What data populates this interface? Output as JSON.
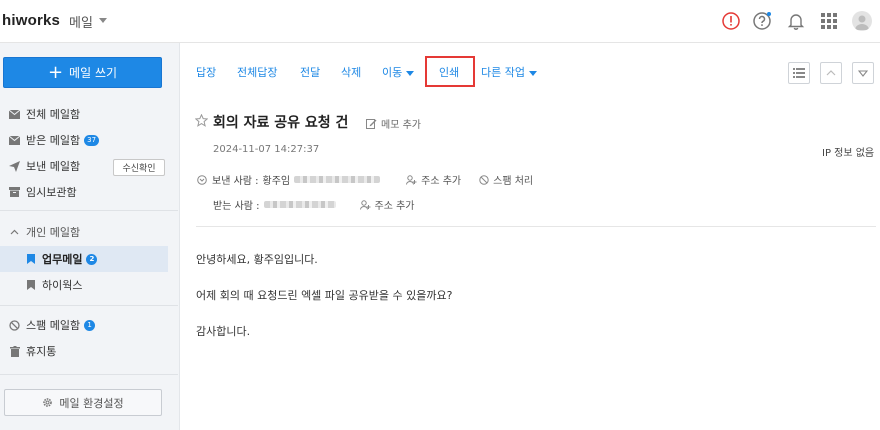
{
  "topbar": {
    "brand": "hiworks",
    "app_name": "메일",
    "icons": [
      "alert-icon",
      "help-icon",
      "bell-icon",
      "apps-grid-icon",
      "avatar-icon"
    ],
    "accent_color": "#1e88e5",
    "alert_color": "#e53935"
  },
  "sidebar": {
    "compose_label": "메일 쓰기",
    "items": [
      {
        "label": "전체 메일함",
        "icon": "envelope-icon"
      },
      {
        "label": "받은 메일함",
        "icon": "envelope-icon",
        "badge": "37"
      },
      {
        "label": "보낸 메일함",
        "icon": "send-icon",
        "button": "수신확인"
      },
      {
        "label": "임시보관함",
        "icon": "archive-icon"
      }
    ],
    "personal_section_label": "개인 메일함",
    "personal_items": [
      {
        "label": "업무메일",
        "icon": "bookmark-icon",
        "badge": "2",
        "selected": true
      },
      {
        "label": "하이웍스",
        "icon": "bookmark-icon"
      }
    ],
    "spam_label": "스팸 메일함",
    "spam_badge": "1",
    "trash_label": "휴지통",
    "settings_label": "메일 환경설정"
  },
  "toolbar": {
    "reply": "답장",
    "reply_all": "전체답장",
    "forward": "전달",
    "delete": "삭제",
    "move": "이동",
    "print": "인쇄",
    "more": "다른 작업"
  },
  "mail": {
    "subject": "회의 자료 공유 요청 건",
    "memo_label": "메모 추가",
    "date": "2024-11-07 14:27:37",
    "ip_info": "IP 정보 없음",
    "sender_label": "보낸 사람 :",
    "sender_name": "황주임",
    "add_address": "주소 추가",
    "spam_action": "스팸 처리",
    "recipient_label": "받는 사람 :",
    "add_address_2": "주소 추가",
    "body": [
      "안녕하세요, 황주임입니다.",
      "어제 회의 때 요청드린 엑셀 파일 공유받을 수 있을까요?",
      "감사합니다."
    ]
  }
}
